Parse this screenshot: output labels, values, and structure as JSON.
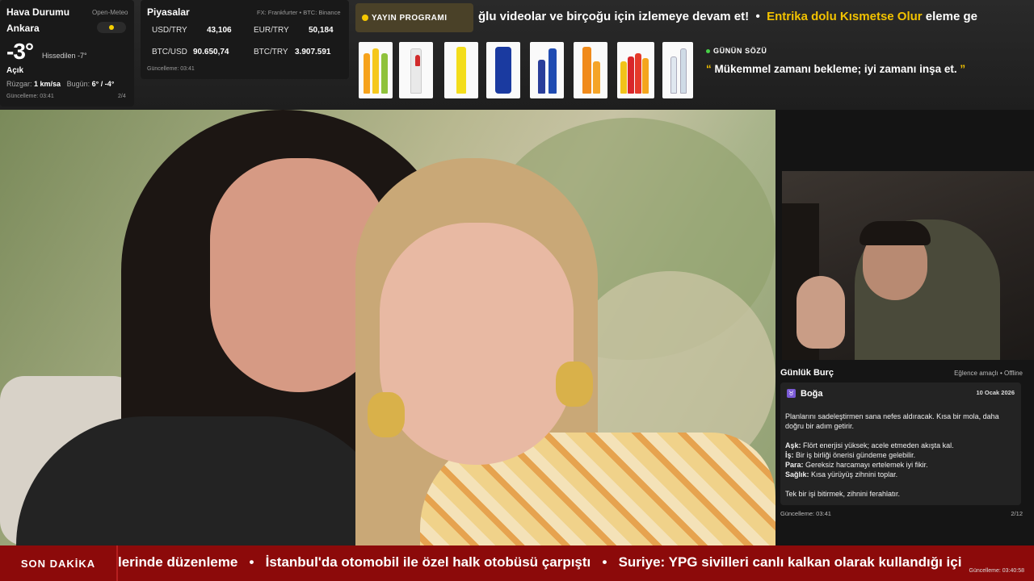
{
  "weather": {
    "title": "Hava Durumu",
    "source": "Open-Meteo",
    "city": "Ankara",
    "temperature": "-3°",
    "feels_like": "Hissedilen -7°",
    "condition": "Açık",
    "wind_label": "Rüzgar:",
    "wind_value": "1 km/sa",
    "today_label": "Bugün:",
    "today_value": "6° / -4°",
    "updated": "Güncelleme: 03:41",
    "page": "2/4"
  },
  "markets": {
    "title": "Piyasalar",
    "source": "FX: Frankfurter • BTC: Binance",
    "rows": [
      {
        "label": "USD/TRY",
        "value": "43,106"
      },
      {
        "label": "EUR/TRY",
        "value": "50,184"
      },
      {
        "label": "BTC/USD",
        "value": "90.650,74"
      },
      {
        "label": "BTC/TRY",
        "value": "3.907.591"
      }
    ],
    "updated": "Güncelleme: 03:41"
  },
  "schedule_button": "YAYIN PROGRAMI",
  "top_ticker": {
    "part1": "ğlu videolar ve birçoğu için izlemeye devam et!",
    "separator": "•",
    "highlight": "Entrika dolu Kısmetse Olur",
    "part2": "eleme ge"
  },
  "quote": {
    "header": "GÜNÜN SÖZÜ",
    "open_mark": "“",
    "text": "Mükemmel zamanı bekleme; iyi zamanı inşa et.",
    "close_mark": "”"
  },
  "horoscope": {
    "title": "Günlük Burç",
    "subtitle": "Eğlence amaçlı • Offline",
    "sign": "Boğa",
    "sign_icon": "♉",
    "date": "10 Ocak 2026",
    "intro": "Planlarını sadeleştirmen sana nefes aldıracak. Kısa bir mola, daha doğru bir adım getirir.",
    "items": [
      {
        "label": "Aşk:",
        "text": "Flört enerjisi yüksek; acele etmeden akışta kal."
      },
      {
        "label": "İş:",
        "text": "Bir iş birliği önerisi gündeme gelebilir."
      },
      {
        "label": "Para:",
        "text": "Gereksiz harcamayı ertelemek iyi fikir."
      },
      {
        "label": "Sağlık:",
        "text": "Kısa yürüyüş zihnini toplar."
      }
    ],
    "closing": "Tek bir işi bitirmek, zihnini ferahlatır.",
    "updated": "Güncelleme: 03:41",
    "page": "2/12"
  },
  "breaking": {
    "label": "SON DAKİKA",
    "items": [
      "lerinde düzenleme",
      "İstanbul'da otomobil ile özel halk otobüsü çarpıştı",
      "Suriye: YPG sivilleri canlı kalkan olarak kullandığı içi"
    ],
    "separator": "•",
    "updated": "Güncelleme: 03:40:58"
  },
  "colors": {
    "accent_yellow": "#f2c200",
    "breaking_red": "#8c0a0a",
    "online_green": "#47d147"
  }
}
